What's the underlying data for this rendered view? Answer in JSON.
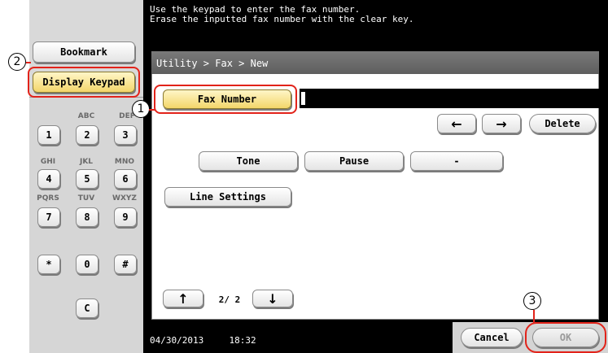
{
  "instructions": [
    "Use the keypad to enter the fax number.",
    "Erase the inputted fax number with the clear key."
  ],
  "left_panel": {
    "bookmark_label": "Bookmark",
    "display_keypad_label": "Display Keypad",
    "keypad": [
      {
        "key": "1",
        "letters": ""
      },
      {
        "key": "2",
        "letters": "ABC"
      },
      {
        "key": "3",
        "letters": "DEF"
      },
      {
        "key": "4",
        "letters": "GHI"
      },
      {
        "key": "5",
        "letters": "JKL"
      },
      {
        "key": "6",
        "letters": "MNO"
      },
      {
        "key": "7",
        "letters": "PQRS"
      },
      {
        "key": "8",
        "letters": "TUV"
      },
      {
        "key": "9",
        "letters": "WXYZ"
      },
      {
        "key": "*",
        "letters": ""
      },
      {
        "key": "0",
        "letters": ""
      },
      {
        "key": "#",
        "letters": ""
      }
    ],
    "clear_label": "C"
  },
  "breadcrumb": "Utility > Fax > New",
  "fax_number_label": "Fax Number",
  "fax_number_value": "",
  "nav": {
    "left_arrow": "←",
    "right_arrow": "→",
    "delete_label": "Delete"
  },
  "buttons": {
    "tone": "Tone",
    "pause": "Pause",
    "dash": "-",
    "line_settings": "Line Settings"
  },
  "pager": {
    "up": "↑",
    "down": "↓",
    "page": "2/ 2"
  },
  "status": {
    "date": "04/30/2013",
    "time": "18:32"
  },
  "footer": {
    "cancel_label": "Cancel",
    "ok_label": "OK"
  },
  "callouts": {
    "one": "1",
    "two": "2",
    "three": "3"
  },
  "colors": {
    "callout_red": "#e2231a",
    "button_yellow": "#f3d66a",
    "screen_black": "#000000"
  }
}
